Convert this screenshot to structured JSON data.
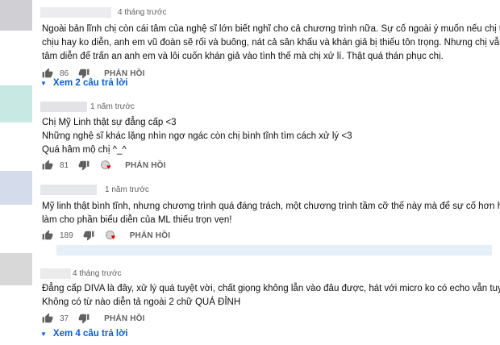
{
  "colors": {
    "link": "#065fd4",
    "secondary_text": "#606060",
    "heart": "#e00000"
  },
  "comments": [
    {
      "timestamp": "4 tháng trước",
      "lines": [
        "Ngoài bản lĩnh chị còn cái tâm của nghệ sĩ lớn biết nghĩ cho cả chương trình nữa. Sự cố ngoài ý muốn nếu chị tỏ ra khó",
        "chịu hay ko diễn, anh em vũ đoàn sẽ rối và buông, nát cả sân khấu và khán giả bị thiếu tôn trọng. Nhưng chị vẫn nhập",
        "tâm diễn để trấn an anh em và lôi cuốn khán giả vào tình thế mà chị xử lí. Thật quá thán phục chị."
      ],
      "likes": "86",
      "reply_label": "PHẢN HỒI",
      "view_replies": "Xem 2 câu trả lời"
    },
    {
      "timestamp": "1 năm trước",
      "lines": [
        "Chị Mỹ Linh thật sự đẳng cấp <3",
        "Những nghệ sĩ khác lặng nhìn ngơ ngác còn chị bình tĩnh tìm cách xử lý <3",
        "Quá hâm mộ chị ^_^"
      ],
      "likes": "81",
      "reply_label": "PHẢN HỒI"
    },
    {
      "timestamp": "1 năm trước",
      "lines": [
        "Mỹ linh thật bình tĩnh, nhưng chương trình quá đáng trách, một chương trình tầm cỡ thế này mà để sự cố hơn hai phút,",
        "làm cho phần biểu diễn của ML thiếu trọn vẹn!"
      ],
      "likes": "189",
      "reply_label": "PHẢN HỒI"
    },
    {
      "timestamp": "4 tháng trước",
      "lines": [
        "Đẳng cấp DIVA là đây, xử lý quá tuyệt vời, chất giọng không lẫn vào đâu được, hát với micro ko có echo vẫn tuyệt vời.",
        "Không có từ nào diễn tả ngoài 2 chữ QUÁ ĐỈNH"
      ],
      "likes": "37",
      "reply_label": "PHẢN HỒI",
      "view_replies": "Xem 4 câu trả lời"
    }
  ]
}
